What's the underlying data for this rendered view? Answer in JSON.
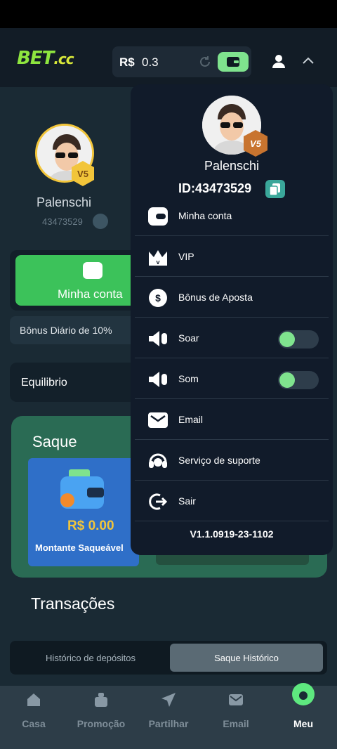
{
  "header": {
    "logo_main": "BET",
    "logo_suffix": ".cc",
    "currency": "R$",
    "balance": "0.3"
  },
  "profile_bg": {
    "name": "Palenschi",
    "id": "43473529",
    "vip_badge": "V5"
  },
  "quick_actions": {
    "minha_conta_label": "Minha conta",
    "bonus_label": "Bônus Diário de 10%",
    "equilibrio_label": "Equilibrio"
  },
  "saque": {
    "title": "Saque",
    "amount": "R$ 0.00",
    "label": "Montante Saqueável"
  },
  "transactions": {
    "title": "Transações",
    "tabs": [
      {
        "label": "Histórico de depósitos",
        "active": false
      },
      {
        "label": "Saque Histórico",
        "active": true
      }
    ]
  },
  "dropdown": {
    "name": "Palenschi",
    "id_text": "ID:43473529",
    "vip_badge": "V5",
    "items": [
      {
        "label": "Minha conta",
        "icon": "wallet-icon"
      },
      {
        "label": "VIP",
        "icon": "crown-icon"
      },
      {
        "label": "Bônus de Aposta",
        "icon": "dollar-icon"
      },
      {
        "label": "Soar",
        "icon": "speaker-icon",
        "toggle": true
      },
      {
        "label": "Som",
        "icon": "speaker-icon",
        "toggle": true
      },
      {
        "label": "Email",
        "icon": "mail-icon"
      },
      {
        "label": "Serviço de suporte",
        "icon": "headset-icon"
      },
      {
        "label": "Sair",
        "icon": "logout-icon"
      }
    ],
    "version": "V1.1.0919-23-1102"
  },
  "bottom_nav": [
    {
      "label": "Casa",
      "icon": "home-icon"
    },
    {
      "label": "Promoção",
      "icon": "gift-icon"
    },
    {
      "label": "Partilhar",
      "icon": "send-icon"
    },
    {
      "label": "Email",
      "icon": "mail-icon"
    },
    {
      "label": "Meu",
      "icon": "user-icon",
      "active": true
    }
  ],
  "colors": {
    "accent_green": "#7fe38e",
    "logo_green": "#8ee53f",
    "panel_bg": "#111b2a",
    "amount_gold": "#f2c53a"
  }
}
